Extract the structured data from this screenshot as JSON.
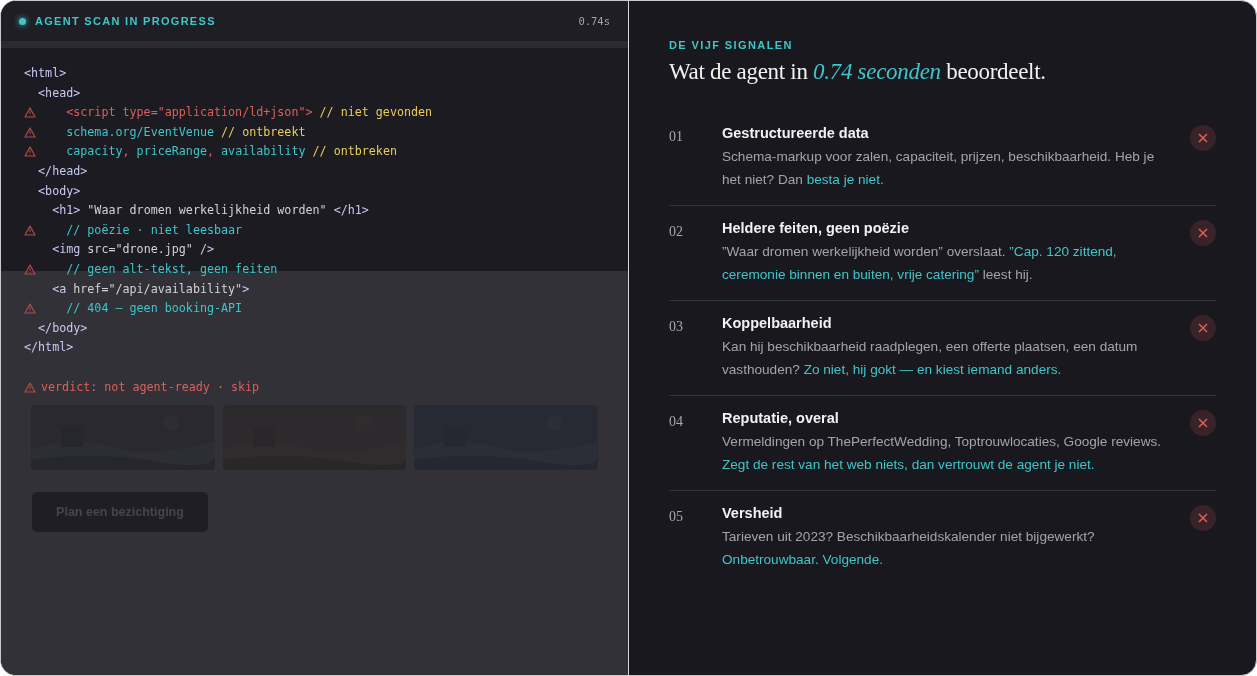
{
  "scan": {
    "label": "AGENT SCAN IN PROGRESS",
    "time": "0.74s",
    "lines": [
      {
        "warning": false,
        "tokens": [
          {
            "kind": "tag",
            "text": "<html>"
          }
        ]
      },
      {
        "warning": false,
        "tokens": [
          {
            "kind": "tag",
            "text": "  <head>"
          }
        ]
      },
      {
        "warning": true,
        "tokens": [
          {
            "kind": "error",
            "text": "      <script type=\"application/ld+json\">"
          },
          {
            "kind": "note",
            "text": " // niet gevonden"
          }
        ]
      },
      {
        "warning": true,
        "tokens": [
          {
            "kind": "value",
            "text": "      schema.org/EventVenue"
          },
          {
            "kind": "note",
            "text": " // ontbreekt"
          }
        ]
      },
      {
        "warning": true,
        "tokens": [
          {
            "kind": "value",
            "text": "      capacity"
          },
          {
            "kind": "error",
            "text": ","
          },
          {
            "kind": "value",
            "text": " priceRange"
          },
          {
            "kind": "error",
            "text": ","
          },
          {
            "kind": "value",
            "text": " availability"
          },
          {
            "kind": "note",
            "text": " // ontbreken"
          }
        ]
      },
      {
        "warning": false,
        "tokens": [
          {
            "kind": "tag",
            "text": "  </head>"
          }
        ]
      },
      {
        "warning": false,
        "tokens": [
          {
            "kind": "tag",
            "text": "  <body>"
          }
        ]
      },
      {
        "warning": false,
        "tokens": [
          {
            "kind": "tag",
            "text": "    <h1>"
          },
          {
            "kind": "string",
            "text": " \"Waar dromen werkelijkheid worden\" "
          },
          {
            "kind": "tag",
            "text": "</h1>"
          }
        ]
      },
      {
        "warning": true,
        "tokens": [
          {
            "kind": "value",
            "text": "      // poëzie · niet leesbaar"
          }
        ]
      },
      {
        "warning": false,
        "tokens": [
          {
            "kind": "tag",
            "text": "    <img"
          },
          {
            "kind": "string",
            "text": " src=\"drone.jpg\" "
          },
          {
            "kind": "tag",
            "text": "/>"
          }
        ]
      },
      {
        "warning": true,
        "tokens": [
          {
            "kind": "value",
            "text": "      // geen alt-tekst, geen feiten"
          }
        ]
      },
      {
        "warning": false,
        "tokens": [
          {
            "kind": "tag",
            "text": "    <a"
          },
          {
            "kind": "string",
            "text": " href=\"/api/availability\""
          },
          {
            "kind": "tag",
            "text": ">"
          }
        ]
      },
      {
        "warning": true,
        "tokens": [
          {
            "kind": "value",
            "text": "      // 404 — geen booking-API"
          }
        ]
      },
      {
        "warning": false,
        "tokens": [
          {
            "kind": "tag",
            "text": "  </body>"
          }
        ]
      },
      {
        "warning": false,
        "tokens": [
          {
            "kind": "tag",
            "text": "</html>"
          }
        ]
      }
    ],
    "verdict": "verdict: not agent-ready · skip"
  },
  "backdrop": {
    "button": "Plan een bezichtiging"
  },
  "signals": {
    "eyebrow": "DE VIJF SIGNALEN",
    "title": "Wat de agent in *0.74 seconden* beoordeelt.",
    "items": [
      {
        "number": "01",
        "title": "Gestructureerde data",
        "description": "Schema-markup voor zalen, capaciteit, prijzen, beschikbaarheid. Heb je het niet? Dan **besta je niet.**",
        "failed": true
      },
      {
        "number": "02",
        "title": "Heldere feiten, geen poëzie",
        "description": "”Waar dromen werkelijkheid worden” overslaat. **”Cap. 120 zittend, ceremonie binnen en buiten, vrije catering”** leest hij.",
        "failed": true
      },
      {
        "number": "03",
        "title": "Koppelbaarheid",
        "description": "Kan hij beschikbaarheid raadplegen, een offerte plaatsen, een datum vasthouden? **Zo niet, hij gokt — en kiest iemand anders.**",
        "failed": true
      },
      {
        "number": "04",
        "title": "Reputatie, overal",
        "description": "Vermeldingen op ThePerfectWedding, Toptrouwlocaties, Google reviews. **Zegt de rest van het web niets, dan vertrouwt de agent je niet.**",
        "failed": true
      },
      {
        "number": "05",
        "title": "Versheid",
        "description": "Tarieven uit 2023? Beschikbaarheidskalender niet bijgewerkt? **Onbetrouwbaar. Volgende.**",
        "failed": true
      }
    ]
  }
}
